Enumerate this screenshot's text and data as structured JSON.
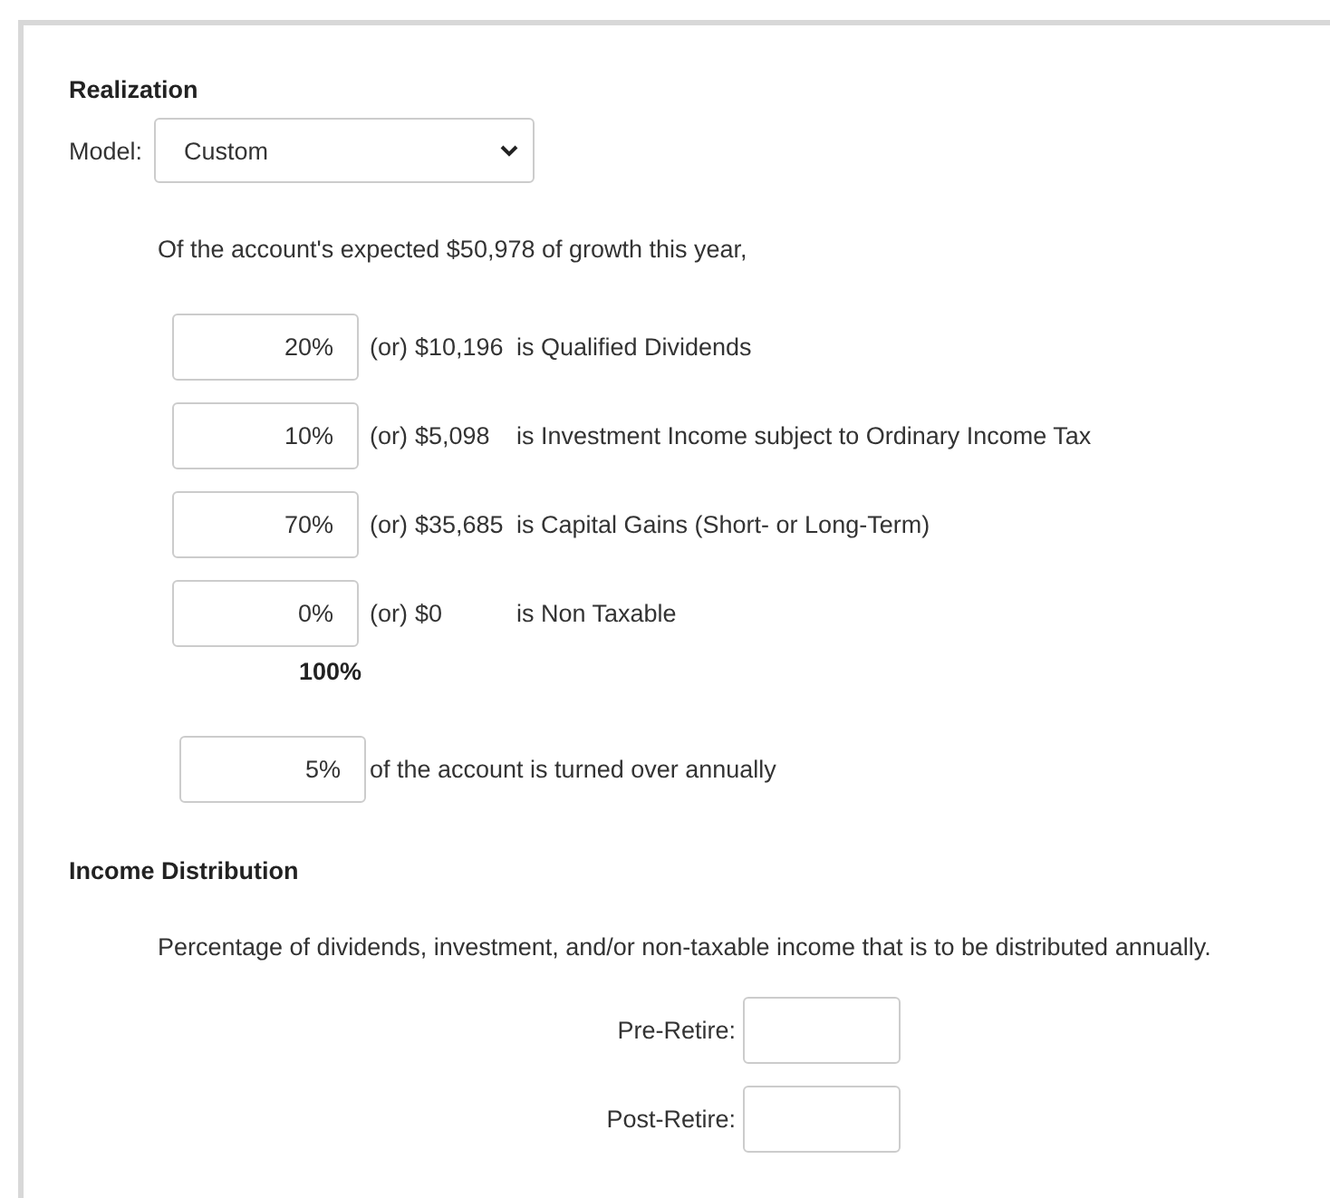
{
  "realization": {
    "heading": "Realization",
    "model": {
      "label": "Model:",
      "value": "Custom"
    },
    "intro": "Of the account's expected $50,978 of growth this year,",
    "rows": [
      {
        "percent": "20%",
        "or": "(or)",
        "amount": "$10,196",
        "description": "is Qualified Dividends"
      },
      {
        "percent": "10%",
        "or": "(or)",
        "amount": "$5,098",
        "description": "is Investment Income subject to Ordinary Income Tax"
      },
      {
        "percent": "70%",
        "or": "(or)",
        "amount": "$35,685",
        "description": "is Capital Gains (Short- or Long-Term)"
      },
      {
        "percent": "0%",
        "or": "(or)",
        "amount": "$0",
        "description": "is Non Taxable"
      }
    ],
    "total": "100%",
    "turnover": {
      "percent": "5%",
      "description": "of the account is turned over annually"
    }
  },
  "income_distribution": {
    "heading": "Income Distribution",
    "description": "Percentage of dividends, investment, and/or non-taxable income that is to be distributed annually.",
    "fields": [
      {
        "label": "Pre-Retire:"
      },
      {
        "label": "Post-Retire:"
      }
    ]
  }
}
